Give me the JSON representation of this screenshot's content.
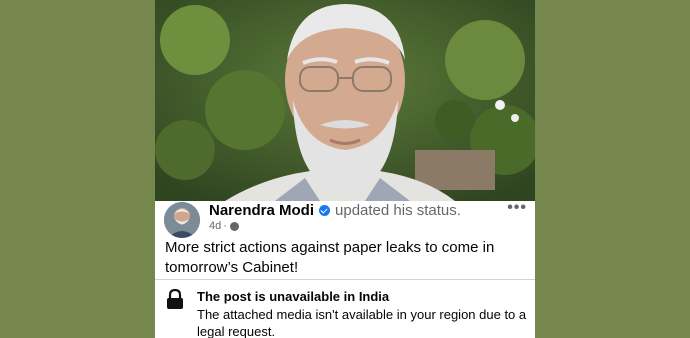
{
  "colors": {
    "page_background": "#75874c",
    "verified_badge": "#1877f2",
    "secondary_text": "#65676b",
    "primary_text": "#050505"
  },
  "post": {
    "author": "Narendra Modi",
    "action": "updated his status.",
    "time": "4d",
    "privacy_icon": "globe-icon",
    "more_icon": "more-options-icon",
    "more_label": "•••",
    "text": "More strict actions against paper leaks to come in tomorrow’s Cabinet!"
  },
  "notice": {
    "icon": "lock-icon",
    "title": "The post is unavailable in India",
    "body": "The attached media isn't available in your region due to a legal request."
  }
}
